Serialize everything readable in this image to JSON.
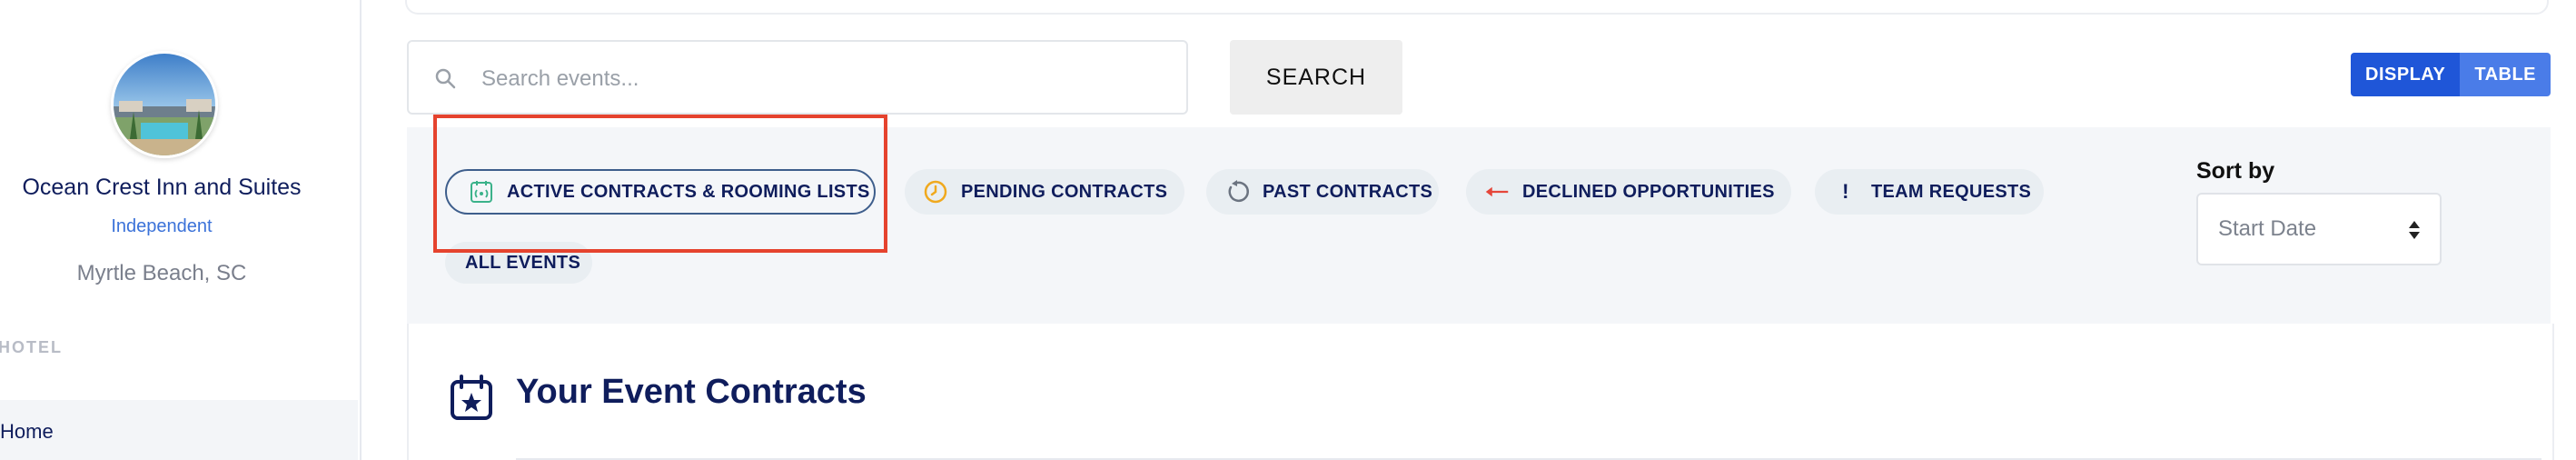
{
  "sidebar": {
    "hotel_name": "Ocean Crest Inn and Suites",
    "hotel_type": "Independent",
    "location": "Myrtle Beach, SC",
    "section_label": "HOTEL",
    "nav": [
      {
        "label": "Home"
      }
    ]
  },
  "search": {
    "placeholder": "Search events...",
    "button_label": "SEARCH"
  },
  "display_toggle": {
    "label": "DISPLAY",
    "value": "TABLE"
  },
  "filters": [
    {
      "label": "ACTIVE CONTRACTS & ROOMING LISTS",
      "icon": "broadcast-icon",
      "active": true
    },
    {
      "label": "PENDING CONTRACTS",
      "icon": "clock-icon",
      "active": false
    },
    {
      "label": "PAST CONTRACTS",
      "icon": "undo-icon",
      "active": false
    },
    {
      "label": "DECLINED OPPORTUNITIES",
      "icon": "arrow-left-icon",
      "active": false
    },
    {
      "label": "TEAM REQUESTS",
      "icon": "exclamation-icon",
      "active": false
    },
    {
      "label": "ALL EVENTS",
      "icon": "",
      "active": false
    }
  ],
  "sort": {
    "label": "Sort by",
    "value": "Start Date"
  },
  "main": {
    "title": "Your Event Contracts",
    "title_icon": "calendar-star-icon"
  },
  "colors": {
    "navy": "#0f1d5c",
    "accent_blue": "#1f56d8",
    "highlight_red": "#e5432e",
    "active_green": "#3bb28a",
    "pending_amber": "#f0a91e",
    "declined_red": "#e5463a"
  }
}
